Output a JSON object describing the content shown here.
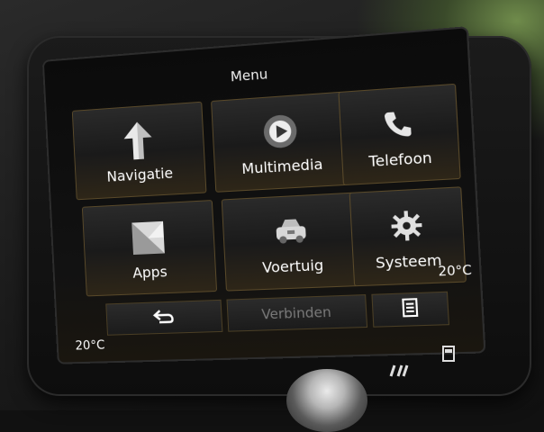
{
  "screen": {
    "title": "Menu",
    "tiles": [
      {
        "label": "Navigatie",
        "icon": "navigation-arrow-icon"
      },
      {
        "label": "Multimedia",
        "icon": "multimedia-play-icon"
      },
      {
        "label": "Telefoon",
        "icon": "phone-icon"
      },
      {
        "label": "Apps",
        "icon": "apps-icon"
      },
      {
        "label": "Voertuig",
        "icon": "car-icon"
      },
      {
        "label": "Systeem",
        "icon": "gear-icon"
      }
    ],
    "bottom_bar": {
      "connect_label": "Verbinden",
      "back_icon": "back-arrow-icon",
      "list_icon": "list-icon"
    },
    "temperature_left": "20°C",
    "temperature_right": "20°C"
  },
  "colors": {
    "tile_border": "#5a4a2a",
    "text": "#ffffff",
    "connect_text": "#7a7a7a"
  }
}
